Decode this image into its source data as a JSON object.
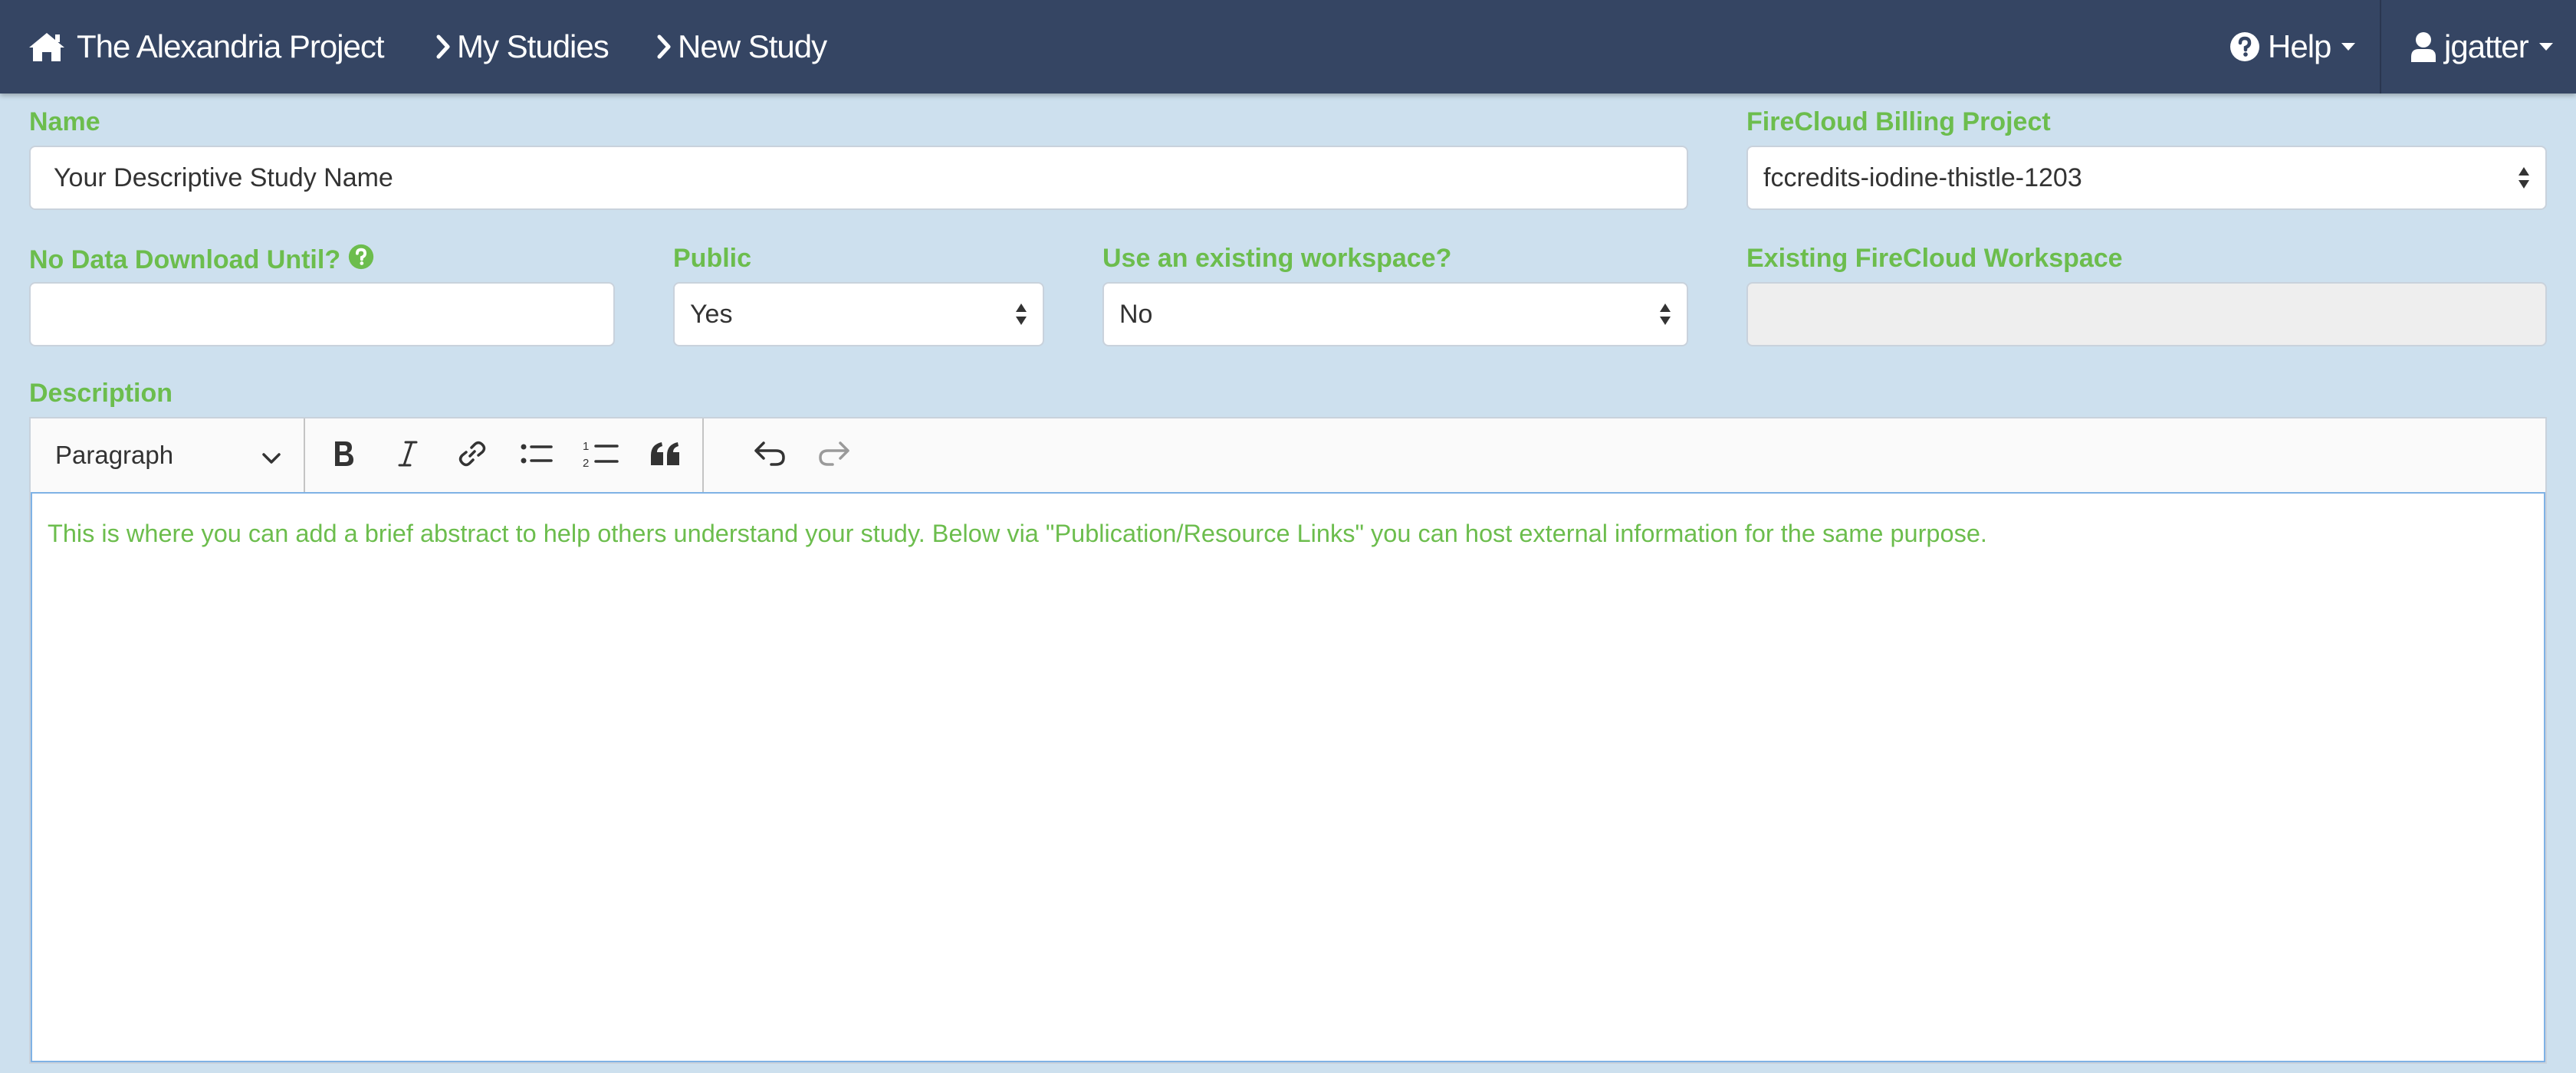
{
  "navbar": {
    "brand": "The Alexandria Project",
    "my_studies": "My Studies",
    "new_study": "New Study",
    "help": "Help",
    "user": "jgatter",
    "bg_color": "#354563"
  },
  "form": {
    "name_label": "Name",
    "name_placeholder": "Your Descriptive Study Name",
    "billing_label": "FireCloud Billing Project",
    "billing_value": "fccredits-iodine-thistle-1203",
    "no_download_label": "No Data Download Until?",
    "no_download_value": "",
    "public_label": "Public",
    "public_value": "Yes",
    "workspace_label": "Use an existing workspace?",
    "workspace_value": "No",
    "existing_workspace_label": "Existing FireCloud Workspace",
    "existing_workspace_value": "",
    "label_color": "#6cbd4d"
  },
  "editor": {
    "description_label": "Description",
    "heading_select": "Paragraph",
    "toolbar_icons": [
      "bold-icon",
      "italic-icon",
      "link-icon",
      "bulleted-list-icon",
      "numbered-list-icon",
      "block-quote-icon",
      "undo-icon",
      "redo-icon"
    ],
    "placeholder": "This is where you can add a brief abstract to help others understand your study. Below via \"Publication/Resource Links\" you can host external information for the same purpose."
  }
}
